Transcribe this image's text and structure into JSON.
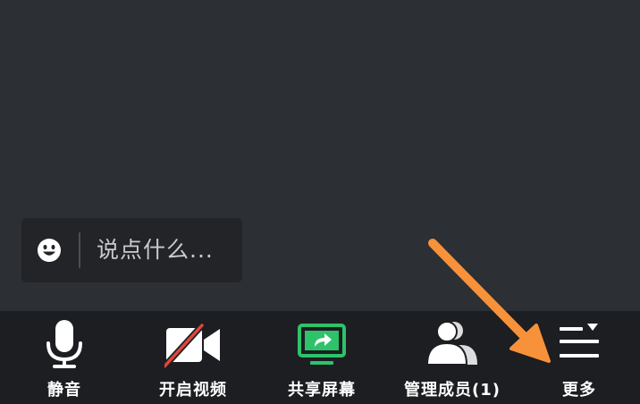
{
  "chat": {
    "placeholder": "说点什么...",
    "emoji_icon": "smiley-face-icon"
  },
  "toolbar": {
    "items": [
      {
        "label": "静音",
        "icon": "microphone-icon"
      },
      {
        "label": "开启视频",
        "icon": "video-camera-off-icon"
      },
      {
        "label": "共享屏幕",
        "icon": "share-screen-icon"
      },
      {
        "label": "管理成员(1)",
        "icon": "members-icon"
      },
      {
        "label": "更多",
        "icon": "more-menu-icon"
      }
    ]
  },
  "colors": {
    "background": "#2c2f33",
    "toolbar": "#1c1e21",
    "chat_box": "#222427",
    "share_green": "#2ec26b",
    "video_off_red": "#e0463a",
    "annotation_arrow": "#f7913a"
  }
}
